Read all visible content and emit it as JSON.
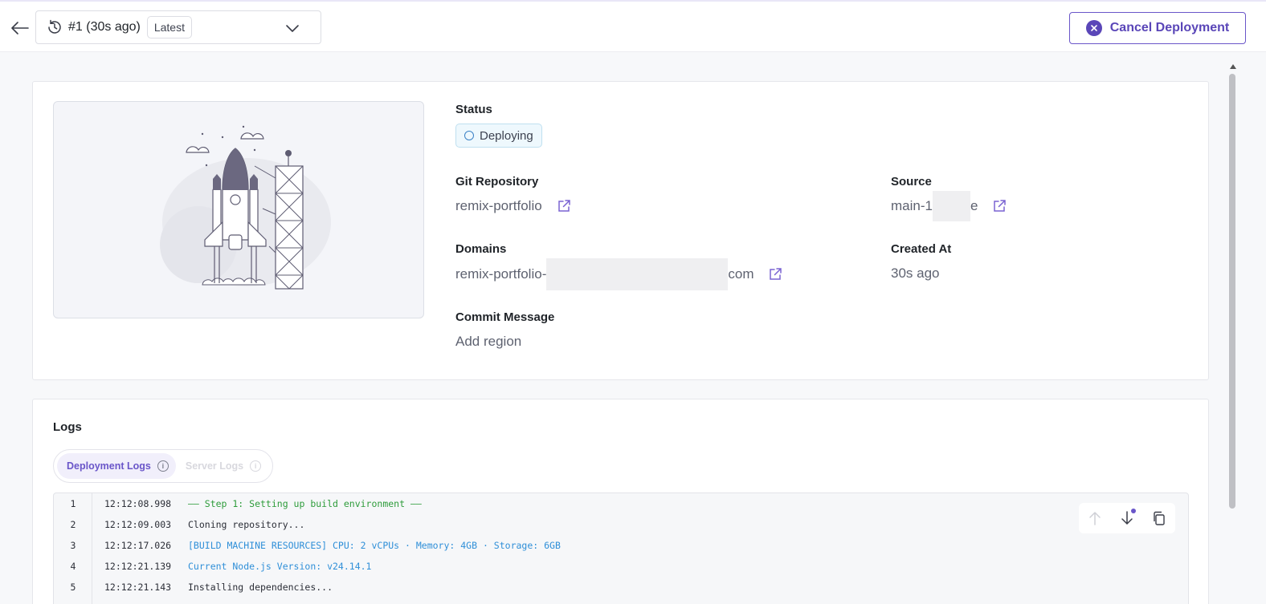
{
  "header": {
    "deployment_label": "#1 (30s ago)",
    "latest_badge": "Latest",
    "cancel_label": "Cancel Deployment"
  },
  "overview": {
    "status": {
      "label": "Status",
      "value": "Deploying"
    },
    "git_repository": {
      "label": "Git Repository",
      "value": "remix-portfolio"
    },
    "source": {
      "label": "Source",
      "prefix": "main-1",
      "suffix": "e"
    },
    "domains": {
      "label": "Domains",
      "prefix": "remix-portfolio-",
      "suffix": "com"
    },
    "created_at": {
      "label": "Created At",
      "value": "30s ago"
    },
    "commit_message": {
      "label": "Commit Message",
      "value": "Add region"
    }
  },
  "logs": {
    "title": "Logs",
    "tabs": [
      {
        "label": "Deployment Logs",
        "active": true
      },
      {
        "label": "Server Logs",
        "active": false
      }
    ],
    "lines": [
      {
        "n": "1",
        "time": "12:12:08.998",
        "text": "—— Step 1: Setting up build environment ——",
        "color": "#2e9c3b"
      },
      {
        "n": "2",
        "time": "12:12:09.003",
        "text": "Cloning repository...",
        "color": "#2b2e37"
      },
      {
        "n": "3",
        "time": "12:12:17.026",
        "text": "[BUILD MACHINE RESOURCES]  CPU: 2 vCPUs · Memory: 4GB · Storage: 6GB",
        "color": "#2f8fd8"
      },
      {
        "n": "4",
        "time": "12:12:21.139",
        "text": "Current Node.js Version: v24.14.1",
        "color": "#2f8fd8"
      },
      {
        "n": "5",
        "time": "12:12:21.143",
        "text": "Installing dependencies...",
        "color": "#2b2e37"
      }
    ]
  },
  "colors": {
    "accent": "#6a56c9",
    "status_blue": "#3c82c6",
    "log_green": "#2e9c3b",
    "log_blue": "#2f8fd8"
  }
}
